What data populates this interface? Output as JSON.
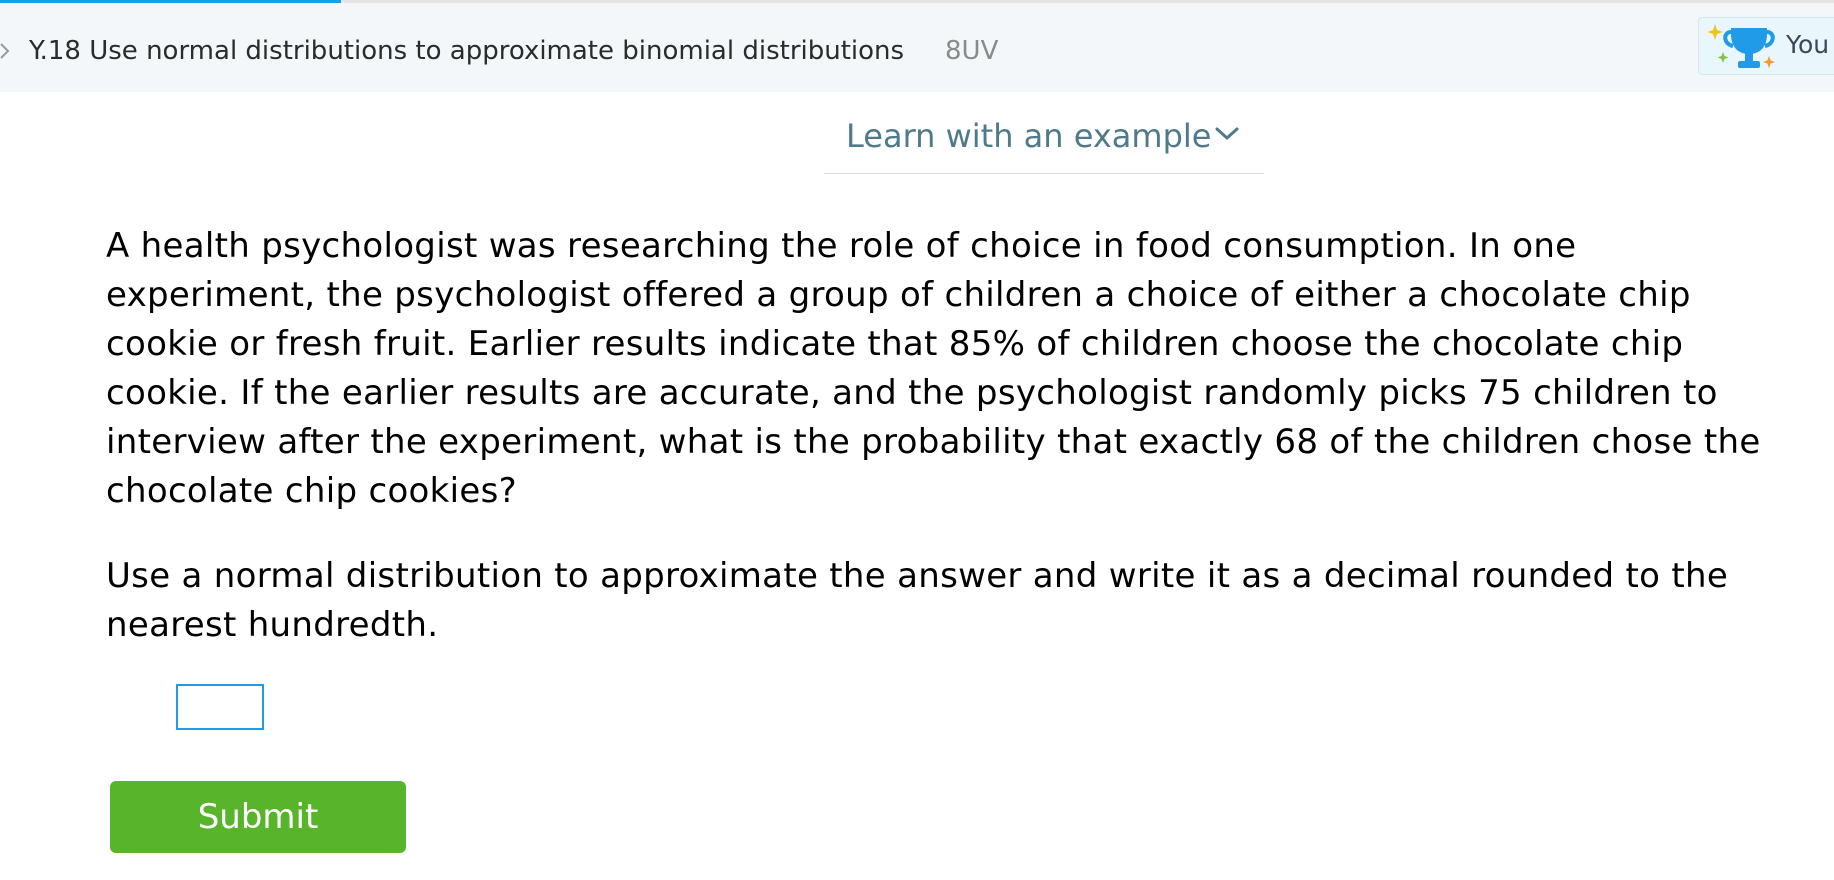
{
  "progress": {
    "fraction": 0.186,
    "color": "#0aa6e8"
  },
  "header": {
    "skill_title": "Y.18 Use normal distributions to approximate binomial distributions",
    "skill_code": "8UV",
    "award_label": "You",
    "icons": {
      "breadcrumb": "chevron-right-icon",
      "award": "trophy-icon"
    }
  },
  "learn": {
    "label": "Learn with an example",
    "icon": "chevron-down-icon"
  },
  "question": {
    "text": "A health psychologist was researching the role of choice in food consumption. In one experiment, the psychologist offered a group of children a choice of either a chocolate chip cookie or fresh fruit. Earlier results indicate that 85% of children choose the chocolate chip cookie. If the earlier results are accurate, and the psychologist randomly picks 75 children to interview after the experiment, what is the probability that exactly 68 of the children chose the chocolate chip cookies?",
    "instruction": "Use a normal distribution to approximate the answer and write it as a decimal rounded to the nearest hundredth."
  },
  "answer": {
    "value": ""
  },
  "submit": {
    "label": "Submit",
    "color": "#58b42a"
  }
}
